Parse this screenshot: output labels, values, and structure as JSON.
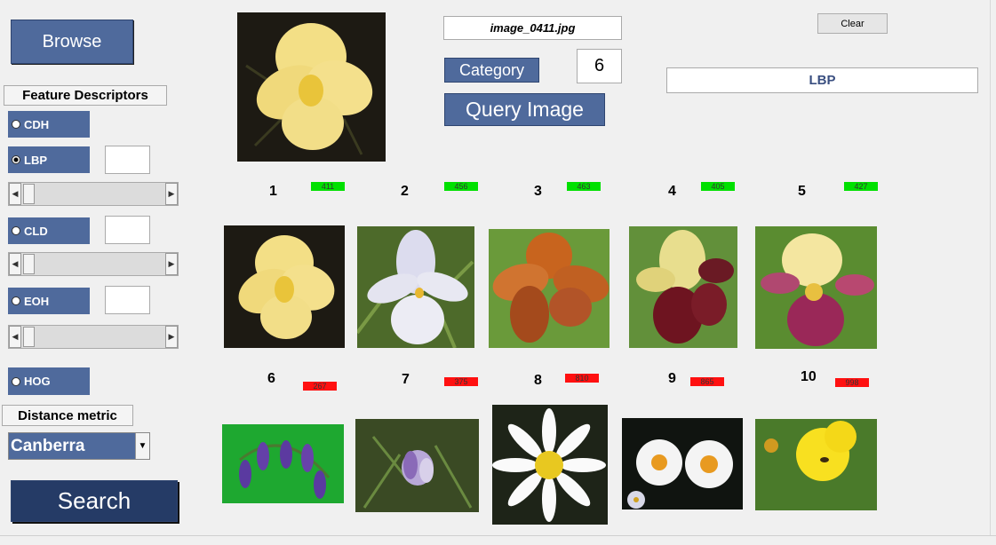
{
  "browse_label": "Browse",
  "filename": "image_0411.jpg",
  "clear_label": "Clear",
  "category_label": "Category",
  "category_value": "6",
  "query_image_label": "Query Image",
  "selected_descriptor": "LBP",
  "feature_descriptors_title": "Feature Descriptors",
  "descriptors": [
    "CDH",
    "LBP",
    "CLD",
    "EOH",
    "HOG"
  ],
  "distance_metric_title": "Distance metric",
  "distance_metric_value": "Canberra",
  "search_label": "Search",
  "results": [
    {
      "rank": "1",
      "score": "411",
      "status": "match",
      "subject": "yellow iris"
    },
    {
      "rank": "2",
      "score": "456",
      "status": "match",
      "subject": "white iris"
    },
    {
      "rank": "3",
      "score": "463",
      "status": "match",
      "subject": "orange iris"
    },
    {
      "rank": "4",
      "score": "405",
      "status": "match",
      "subject": "maroon and yellow iris"
    },
    {
      "rank": "5",
      "score": "427",
      "status": "match",
      "subject": "purple and cream iris"
    },
    {
      "rank": "6",
      "score": "267",
      "status": "mismatch",
      "subject": "bluebells"
    },
    {
      "rank": "7",
      "score": "375",
      "status": "mismatch",
      "subject": "crocus"
    },
    {
      "rank": "8",
      "score": "810",
      "status": "mismatch",
      "subject": "daisy"
    },
    {
      "rank": "9",
      "score": "865",
      "status": "mismatch",
      "subject": "daisies"
    },
    {
      "rank": "10",
      "score": "998",
      "status": "mismatch",
      "subject": "dandelion"
    }
  ],
  "colors": {
    "button": "#4f6a9c",
    "search_button": "#253b66",
    "match": "#00e000",
    "mismatch": "#ff1010",
    "descriptor_text": "#3a4f80"
  },
  "icons": {
    "slider_left": "arrow-left-icon",
    "slider_right": "arrow-right-icon",
    "dropdown": "chevron-down-icon"
  }
}
